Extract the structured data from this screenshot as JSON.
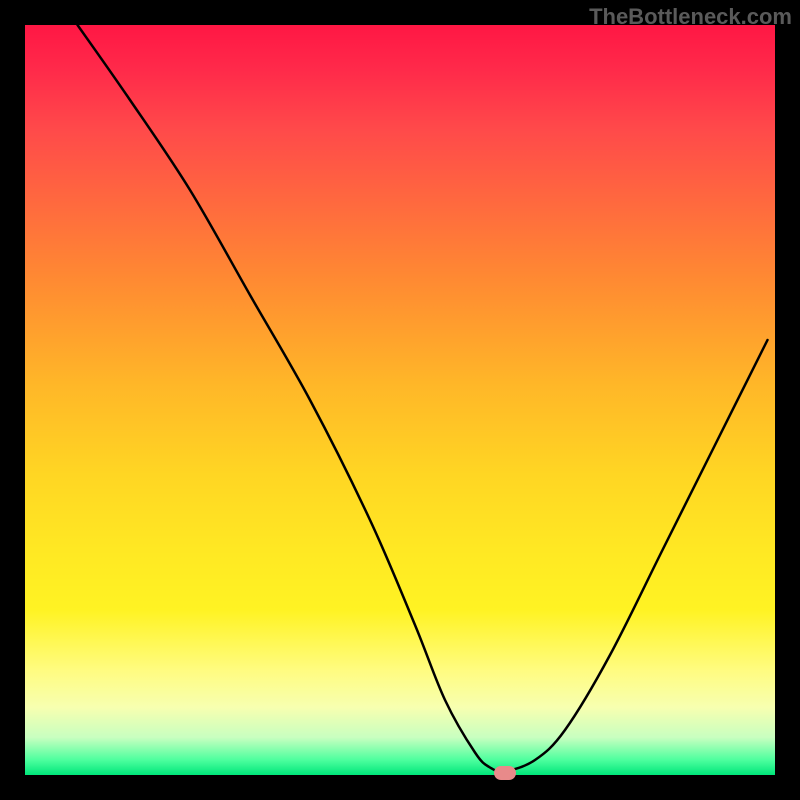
{
  "watermark": "TheBottleneck.com",
  "chart_data": {
    "type": "line",
    "title": "",
    "xlabel": "",
    "ylabel": "",
    "xlim": [
      0,
      100
    ],
    "ylim": [
      0,
      100
    ],
    "series": [
      {
        "name": "bottleneck-curve",
        "x": [
          7,
          14,
          22,
          30,
          38,
          46,
          52,
          56,
          60,
          62,
          64,
          68,
          72,
          78,
          85,
          92,
          99
        ],
        "y": [
          100,
          90,
          78,
          64,
          50,
          34,
          20,
          10,
          3,
          1,
          0.5,
          2,
          6,
          16,
          30,
          44,
          58
        ]
      }
    ],
    "marker": {
      "x": 64,
      "y": 0.3
    },
    "gradient_stops": [
      {
        "pct": 0,
        "color": "#ff1744"
      },
      {
        "pct": 50,
        "color": "#ffd623"
      },
      {
        "pct": 90,
        "color": "#fffc80"
      },
      {
        "pct": 100,
        "color": "#00e67a"
      }
    ]
  }
}
